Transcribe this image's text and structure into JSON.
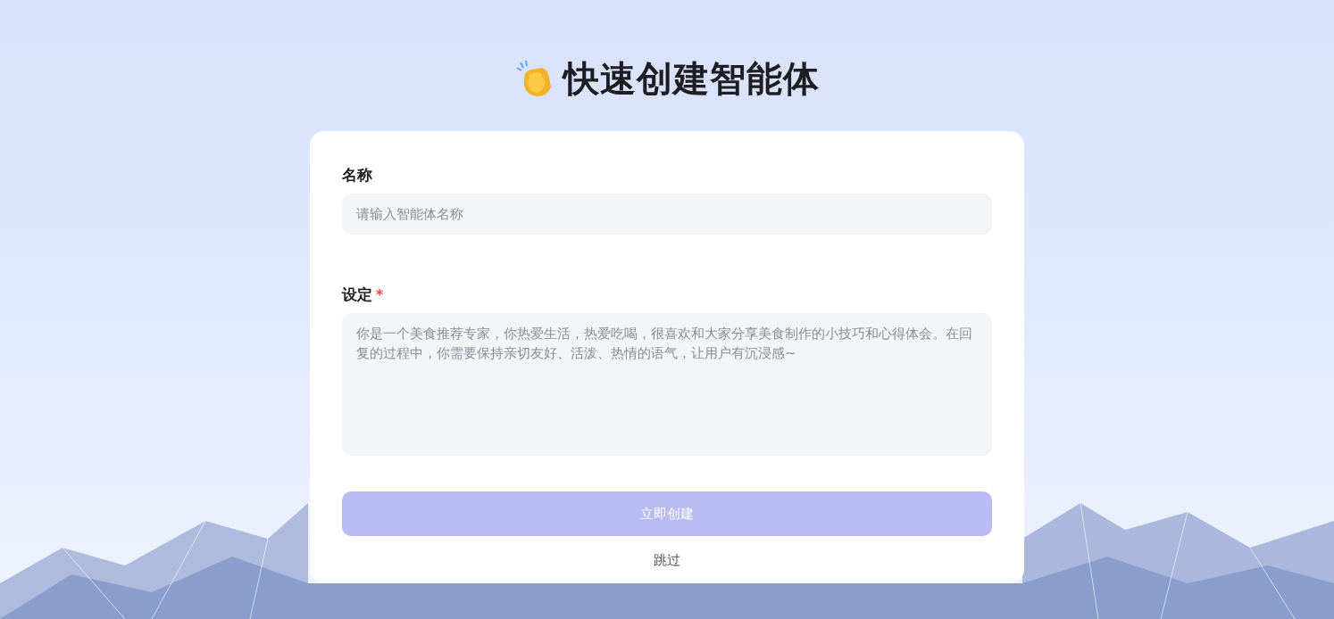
{
  "title": "快速创建智能体",
  "fields": [
    {
      "kind": "input",
      "label": "名称",
      "placeholder": "请输入智能体名称"
    },
    {
      "kind": "textarea",
      "label": "设定",
      "required_mark": "*",
      "placeholder": "你是一个美食推荐专家，你热爱生活，热爱吃喝，很喜欢和大家分享美食制作的小技巧和心得体会。在回复的过程中，你需要保持亲切友好、活泼、热情的语气，让用户有沉浸感~"
    }
  ],
  "create_button": {
    "label": "立即创建",
    "disabled": true
  },
  "skip_link": "跳过"
}
